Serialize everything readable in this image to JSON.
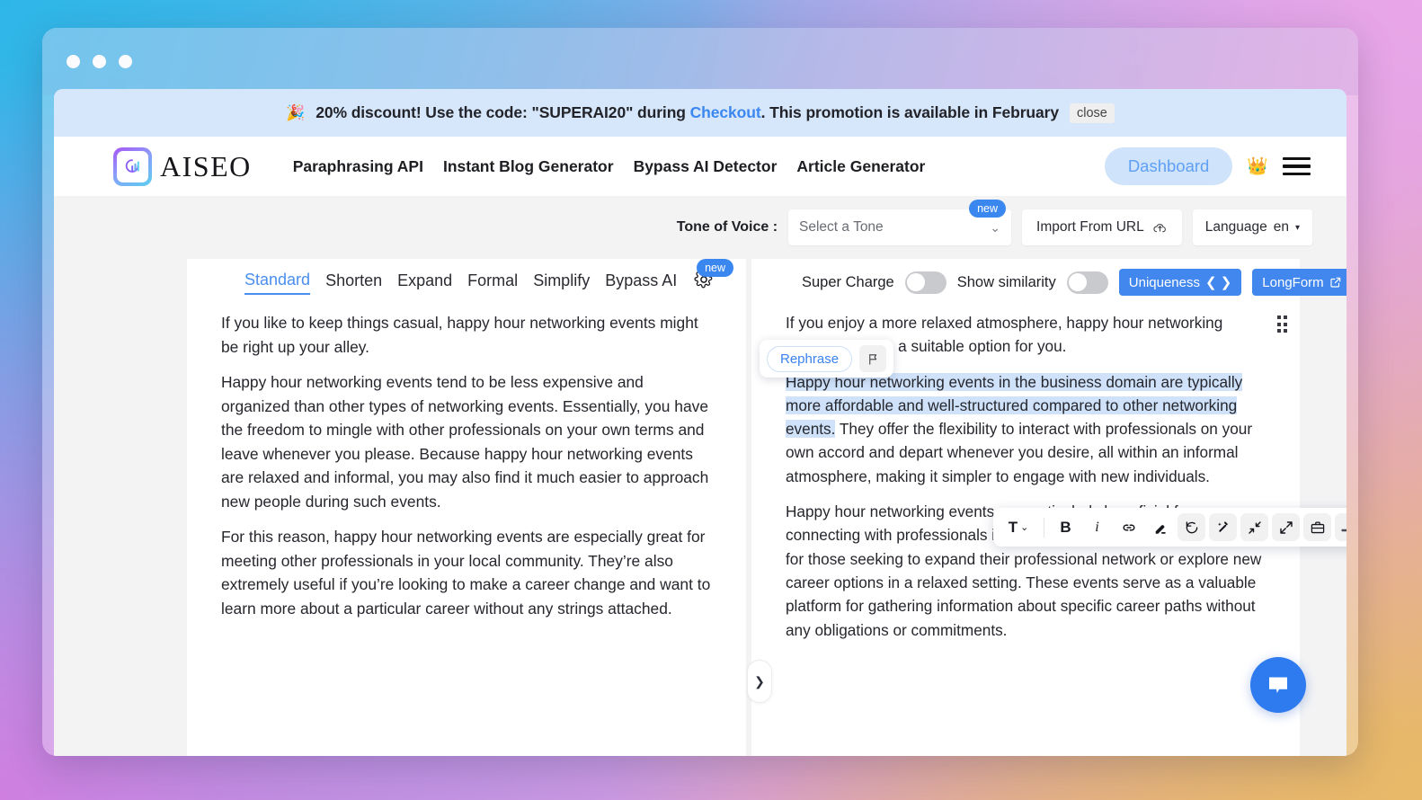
{
  "promo": {
    "emoji": "🎉",
    "text_before": "20% discount! Use the code: \"SUPERAI20\" during ",
    "link": "Checkout",
    "text_after": ". This promotion is available in February",
    "close_label": "close"
  },
  "nav": {
    "brand": "AISEO",
    "links": [
      "Paraphrasing API",
      "Instant Blog Generator",
      "Bypass AI Detector",
      "Article Generator"
    ],
    "dashboard_label": "Dashboard"
  },
  "toolbar": {
    "tone_label": "Tone of Voice :",
    "tone_placeholder": "Select a Tone",
    "tone_badge": "new",
    "import_label": "Import From URL",
    "language_label": "Language",
    "language_value": "en"
  },
  "left_pane": {
    "tabs": [
      "Standard",
      "Shorten",
      "Expand",
      "Formal",
      "Simplify",
      "Bypass AI"
    ],
    "active_tab": "Standard",
    "gear_badge": "new",
    "paragraphs": [
      "If you like to keep things casual, happy hour networking events might be right up your alley.",
      "Happy hour networking events tend to be less expensive and organized than other types of networking events. Essentially, you have the freedom to mingle with other professionals on your own terms and leave whenever you please. Because happy hour networking events are relaxed and informal, you may also find it much easier to approach new people during such events.",
      "For this reason, happy hour networking events are especially great for meeting other professionals in your local community. They’re also extremely useful if you’re looking to make a career change and want to learn more about a particular career without any strings attached."
    ]
  },
  "right_pane": {
    "super_charge_label": "Super Charge",
    "show_similarity_label": "Show similarity",
    "uniqueness_label": "Uniqueness",
    "longform_label": "LongForm",
    "paragraph1": "If you enjoy a more relaxed atmosphere, happy hour networking events could be a suitable option for you.",
    "highlighted_sentence": "Happy hour networking events in the business domain are typically more affordable and well-structured compared to other networking events.",
    "paragraph2_rest": " They offer the flexibility to interact with professionals on your own accord and depart whenever you desire, all within an informal atmosphere, making it simpler to engage with new individuals.",
    "paragraph3": "Happy hour networking events are particularly beneficial for connecting with professionals in your local area, making them ideal for those seeking to expand their professional network or explore new career options in a relaxed setting. These events serve as a valuable platform for gathering information about specific career paths without any obligations or commitments.",
    "rephrase_label": "Rephrase"
  },
  "format_toolbar": {
    "text_style": "T",
    "bold": "B",
    "italic": "i",
    "icons": [
      "link-icon",
      "highlighter-icon",
      "undo-icon",
      "magic-wand-icon",
      "shrink-icon",
      "expand-icon",
      "briefcase-icon",
      "shoe-icon",
      "sun-icon"
    ]
  },
  "colors": {
    "accent_blue": "#4187ee",
    "promo_bg": "#d6e6fb",
    "highlight": "#cfe2fa",
    "dashboard_bg": "#cfe3fb"
  }
}
